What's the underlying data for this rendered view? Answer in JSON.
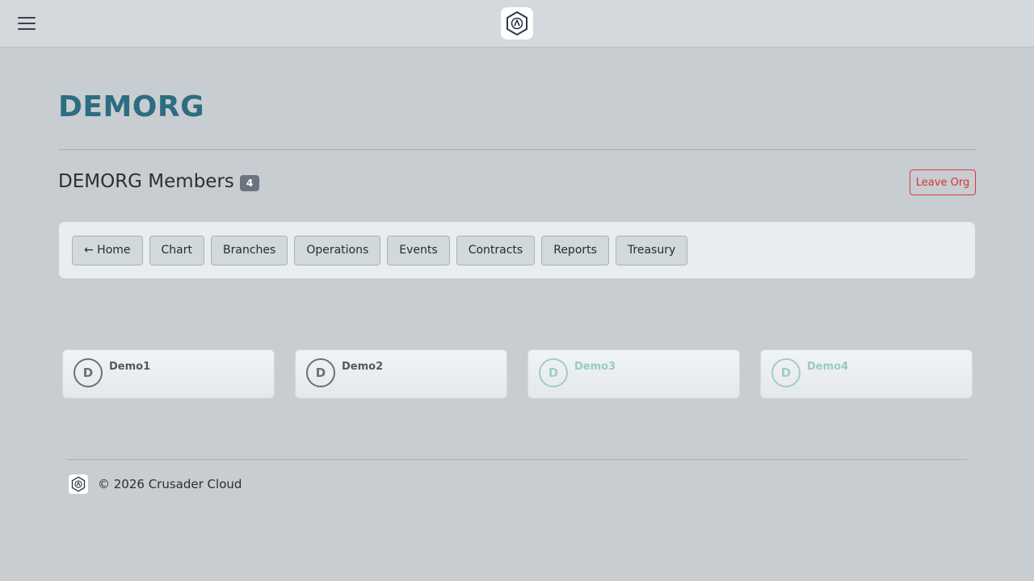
{
  "header": {
    "menu_icon": "hamburger-menu-icon",
    "logo_icon": "hexagon-logo-icon"
  },
  "org": {
    "title": "DEMORG"
  },
  "members_section": {
    "heading": "DEMORG Members",
    "count": "4",
    "leave_label": "Leave Org"
  },
  "nav": {
    "buttons": [
      {
        "label": "← Home"
      },
      {
        "label": "Chart"
      },
      {
        "label": "Branches"
      },
      {
        "label": "Operations"
      },
      {
        "label": "Events"
      },
      {
        "label": "Contracts"
      },
      {
        "label": "Reports"
      },
      {
        "label": "Treasury"
      }
    ]
  },
  "members": [
    {
      "initial": "D",
      "name": "Demo1",
      "status": "active"
    },
    {
      "initial": "D",
      "name": "Demo2",
      "status": "active"
    },
    {
      "initial": "D",
      "name": "Demo3",
      "status": "inactive"
    },
    {
      "initial": "D",
      "name": "Demo4",
      "status": "inactive"
    }
  ],
  "footer": {
    "logo_icon": "hexagon-logo-icon",
    "text": "© 2026 Crusader Cloud"
  },
  "colors": {
    "accent": "#2c6d80",
    "danger": "#cf3434",
    "inactive_member": "#9ccbbd",
    "background": "#c8cdd1"
  }
}
